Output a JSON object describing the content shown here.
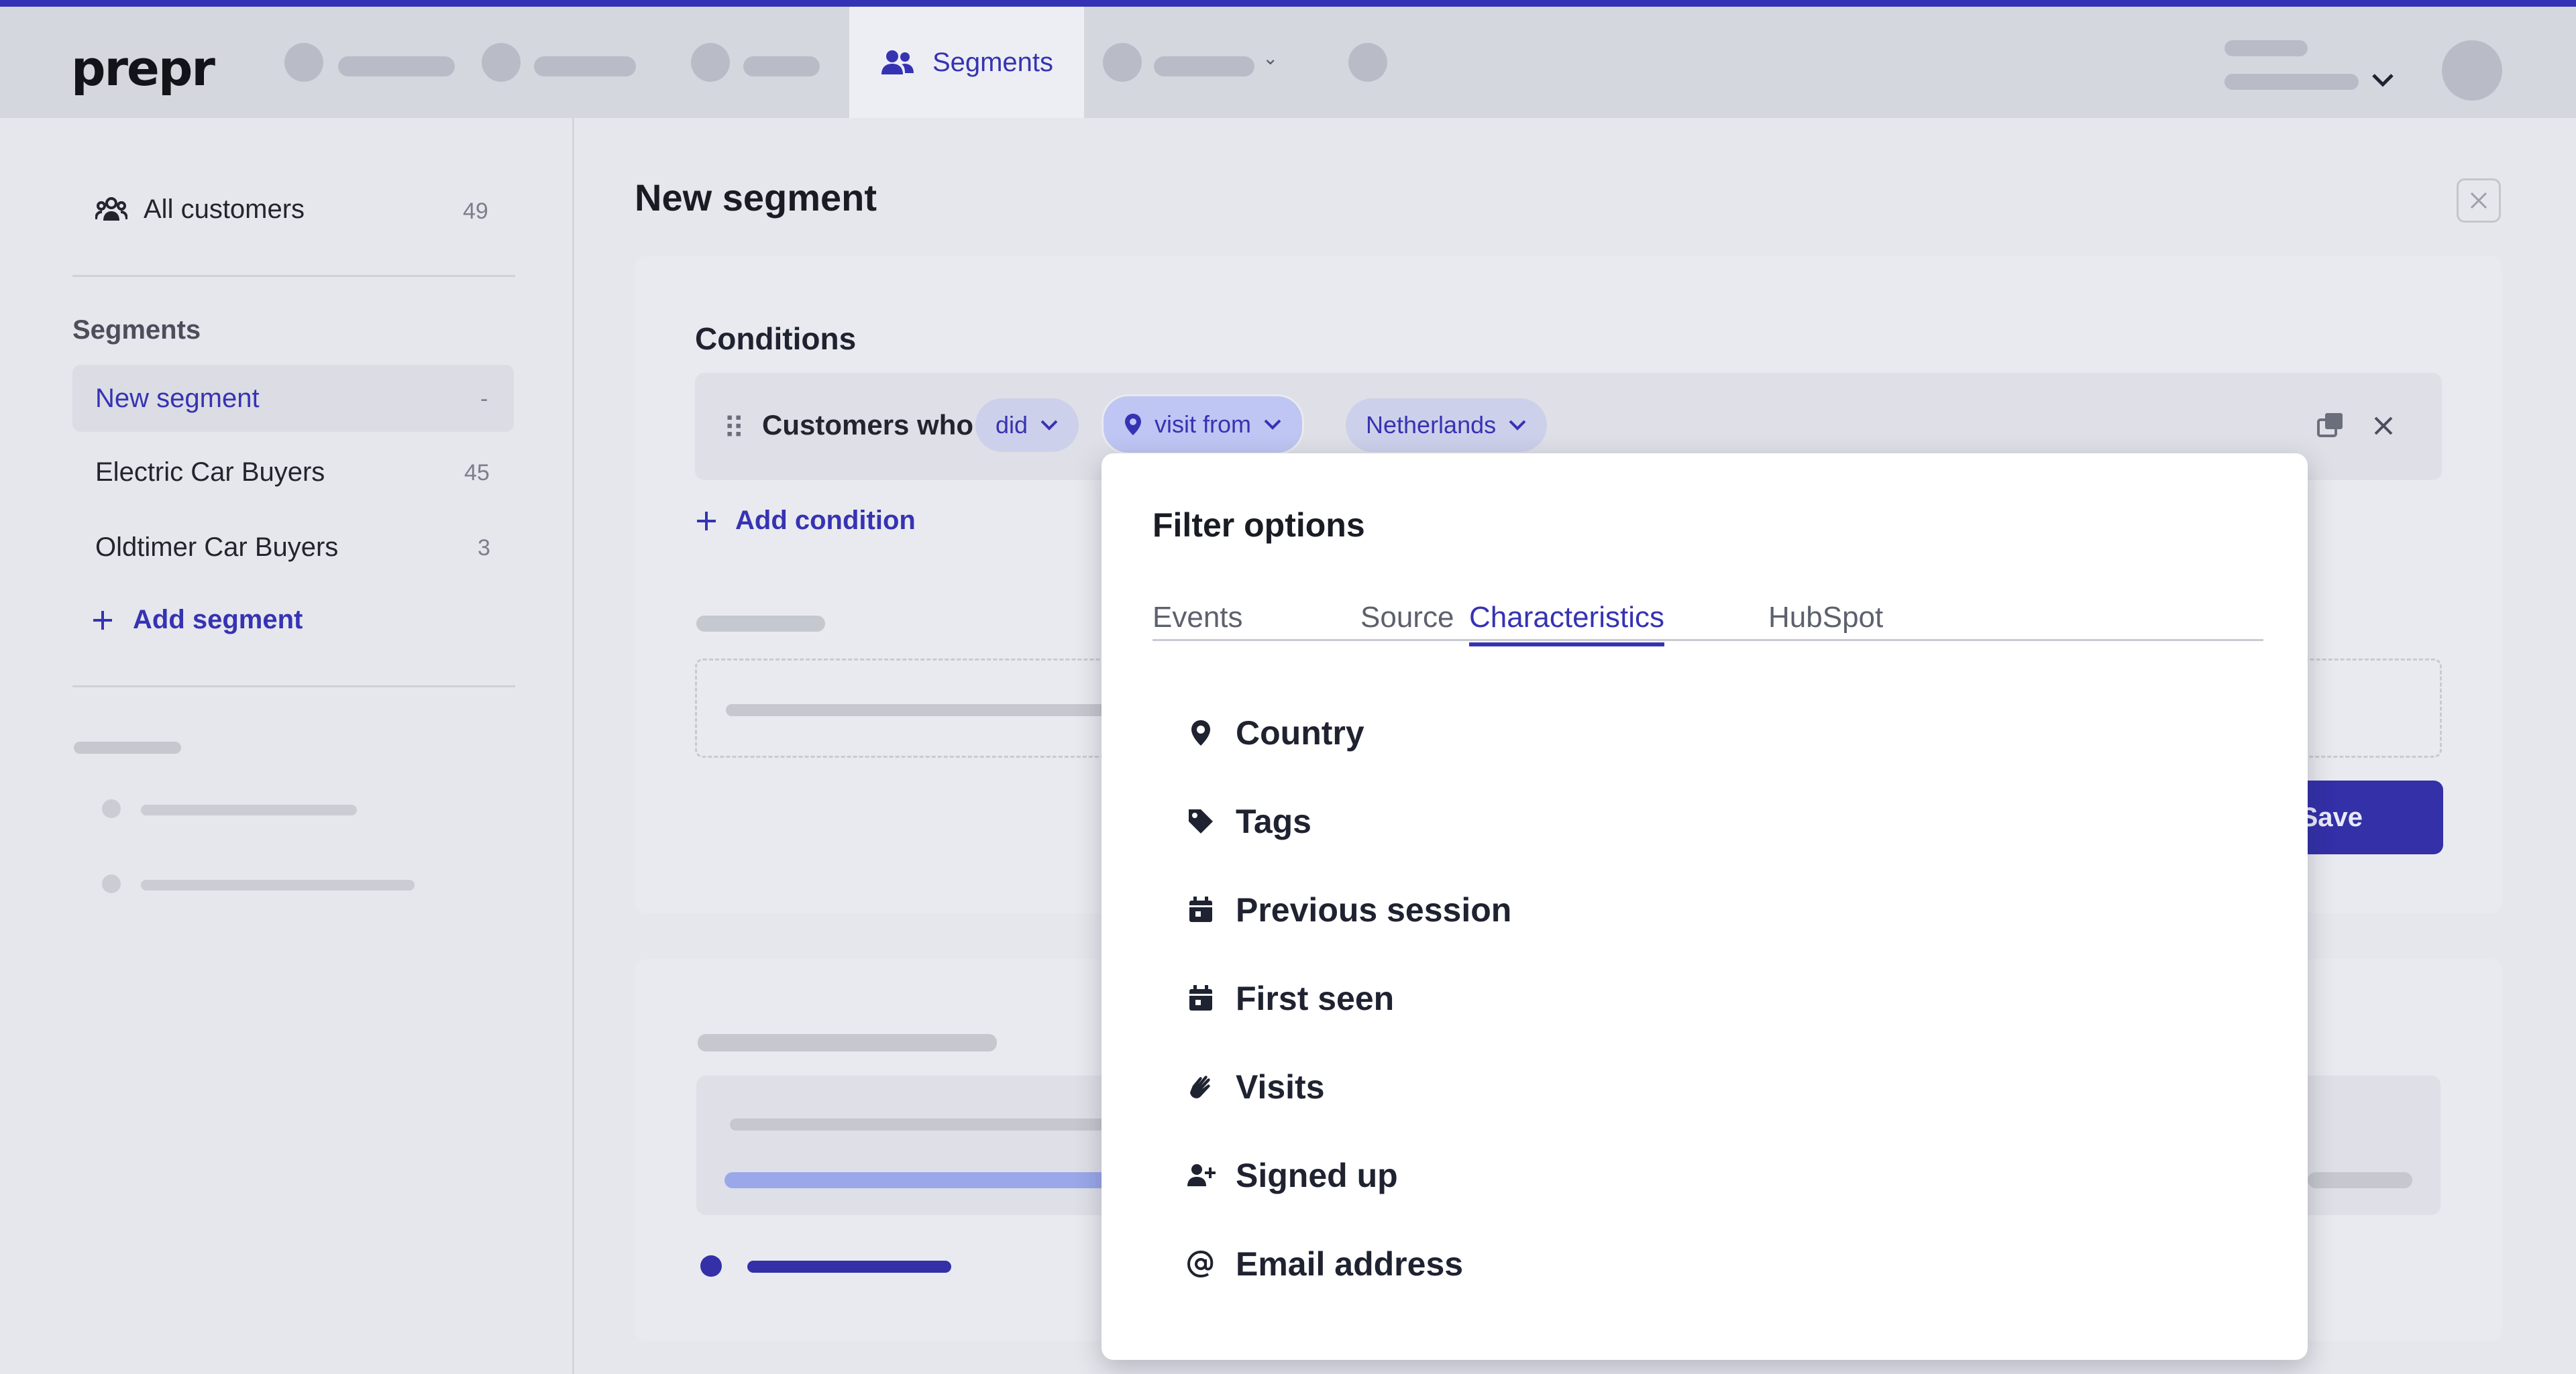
{
  "app": {
    "logo": "prepr",
    "active_nav": "Segments"
  },
  "sidebar": {
    "all_customers": {
      "label": "All customers",
      "count": "49"
    },
    "heading": "Segments",
    "items": [
      {
        "label": "New segment",
        "count": "-"
      },
      {
        "label": "Electric Car Buyers",
        "count": "45"
      },
      {
        "label": "Oldtimer Car Buyers",
        "count": "3"
      }
    ],
    "add_label": "Add segment"
  },
  "main": {
    "title": "New segment",
    "conditions_title": "Conditions",
    "condition": {
      "prefix": "Customers who",
      "did": "did",
      "event": "visit from",
      "value": "Netherlands"
    },
    "add_condition": "Add condition",
    "save_label": "Save"
  },
  "popover": {
    "title": "Filter options",
    "tabs": [
      "Events",
      "Source",
      "Characteristics",
      "HubSpot"
    ],
    "active_tab": "Characteristics",
    "options": [
      {
        "label": "Country",
        "icon": "map-pin-icon"
      },
      {
        "label": "Tags",
        "icon": "tag-icon"
      },
      {
        "label": "Previous session",
        "icon": "calendar-icon"
      },
      {
        "label": "First seen",
        "icon": "calendar-icon"
      },
      {
        "label": "Visits",
        "icon": "hand-wave-icon"
      },
      {
        "label": "Signed up",
        "icon": "user-plus-icon"
      },
      {
        "label": "Email address",
        "icon": "at-sign-icon"
      }
    ]
  },
  "colors": {
    "accent": "#3633b3",
    "top_stripe": "#3433b6"
  }
}
